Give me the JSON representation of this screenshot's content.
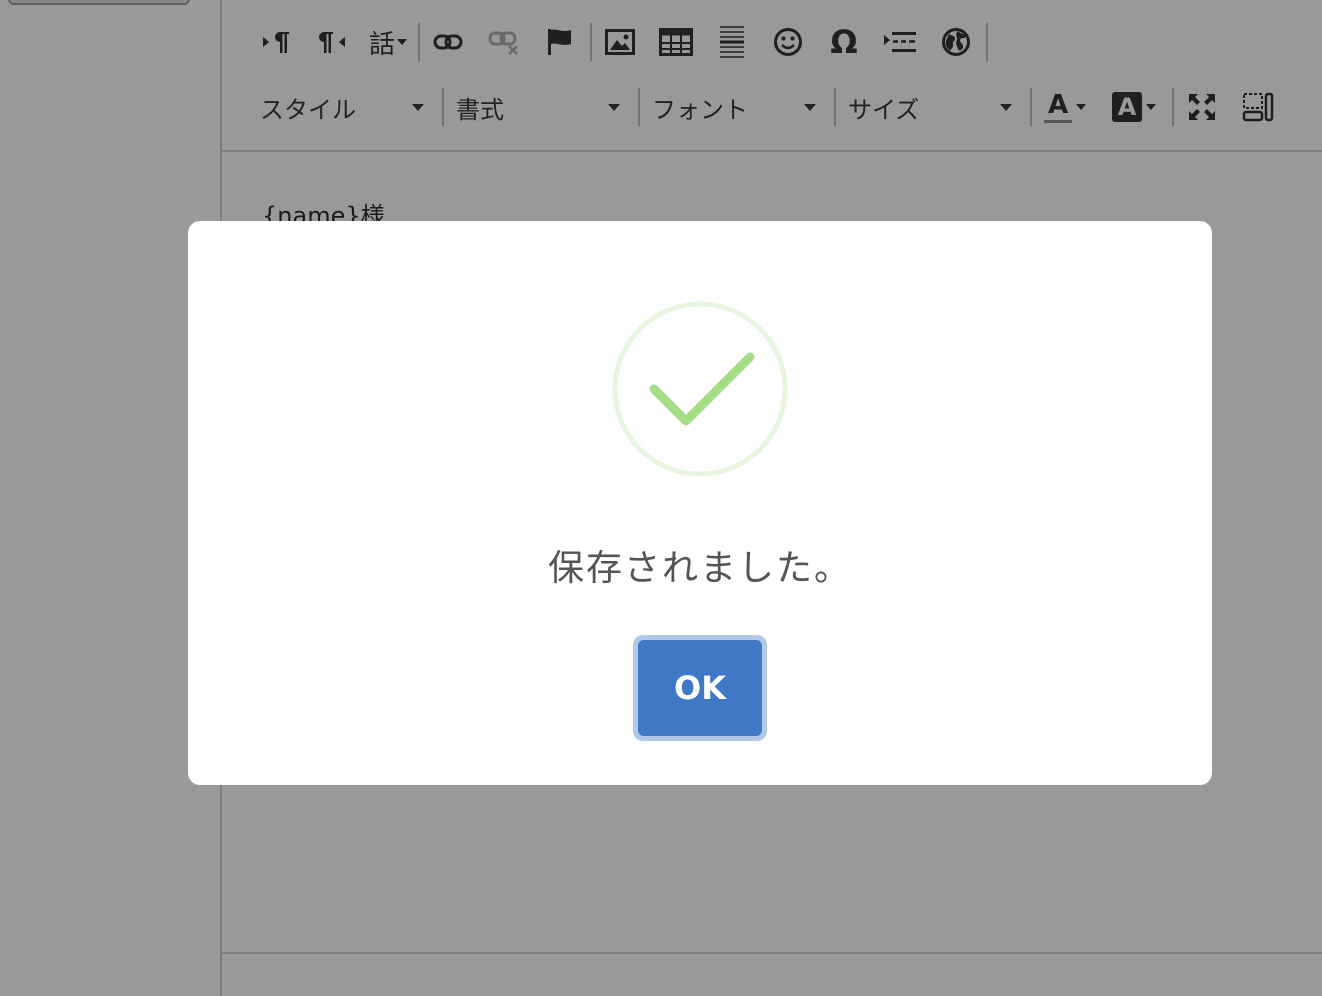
{
  "editor": {
    "content_text": "{name}様",
    "toolbar_row1": [
      {
        "name": "ltr-icon"
      },
      {
        "name": "rtl-icon"
      },
      {
        "name": "language-icon",
        "glyph": "話"
      },
      {
        "name": "link-icon"
      },
      {
        "name": "unlink-icon"
      },
      {
        "name": "anchor-flag-icon"
      },
      {
        "name": "image-icon"
      },
      {
        "name": "table-icon"
      },
      {
        "name": "horizontal-line-icon"
      },
      {
        "name": "smiley-icon"
      },
      {
        "name": "special-char-icon",
        "glyph": "Ω"
      },
      {
        "name": "page-break-icon"
      },
      {
        "name": "iframe-globe-icon"
      }
    ],
    "toolbar_row2": {
      "style_label": "スタイル",
      "format_label": "書式",
      "font_label": "フォント",
      "size_label": "サイズ",
      "text_color_glyph": "A",
      "bg_color_glyph": "A"
    }
  },
  "modal": {
    "title": "保存されました。",
    "ok_label": "OK",
    "success_color": "#a5dc86",
    "button_color": "#3f78c4"
  }
}
